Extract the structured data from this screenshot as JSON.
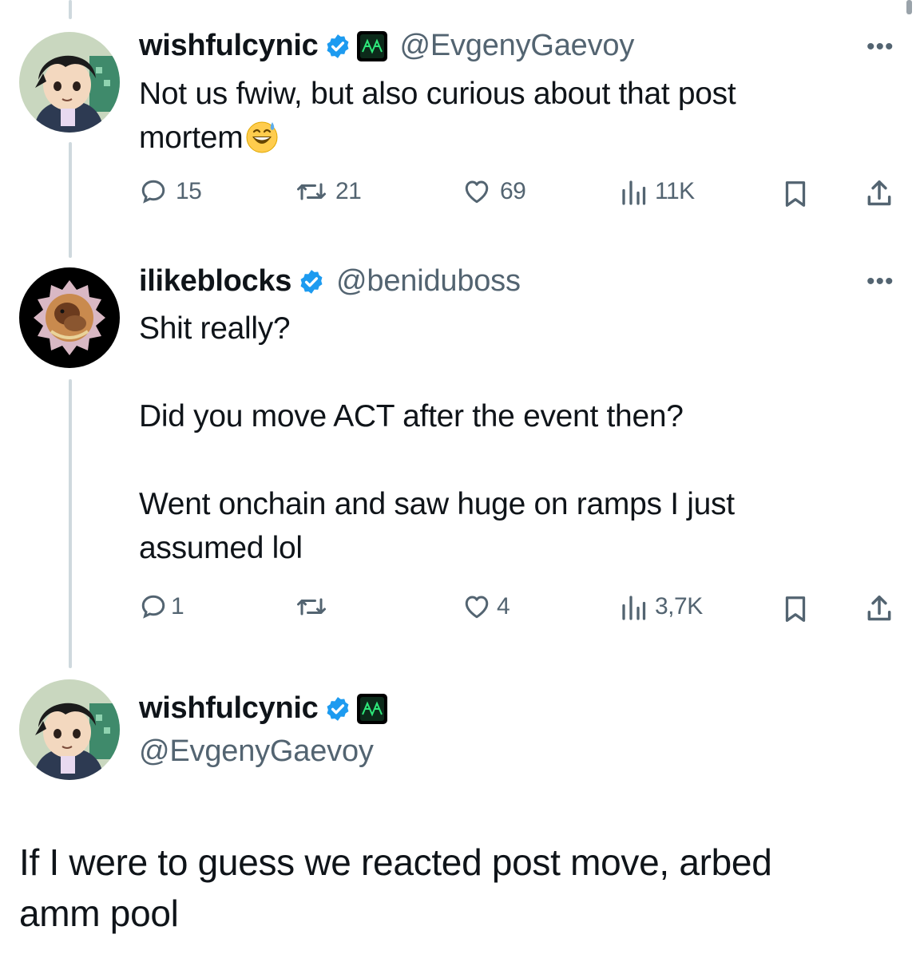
{
  "tweets": [
    {
      "name": "wishfulcynic",
      "handle": "@EvgenyGaevoy",
      "text": "Not us fwiw, but also curious about that post\nmortem",
      "emoji": "sweat-smile-emoji",
      "more": "•••",
      "stats": {
        "replies": "15",
        "retweets": "21",
        "likes": "69",
        "views": "11K"
      }
    },
    {
      "name": "ilikeblocks",
      "handle": "@beniduboss",
      "text": "Shit really?\n\nDid you move ACT after the event then?\n\nWent onchain and saw huge on ramps I just\nassumed lol",
      "more": "•••",
      "stats": {
        "replies": "1",
        "retweets": "",
        "likes": "4",
        "views": "3,7K"
      }
    },
    {
      "name": "wishfulcynic",
      "handle": "@EvgenyGaevoy",
      "text": "If I were to guess we reacted post move, arbed\namm pool"
    }
  ],
  "colors": {
    "text": "#0f1419",
    "muted": "#536471",
    "verified": "#1d9bf0",
    "thread": "#cfd9de"
  }
}
